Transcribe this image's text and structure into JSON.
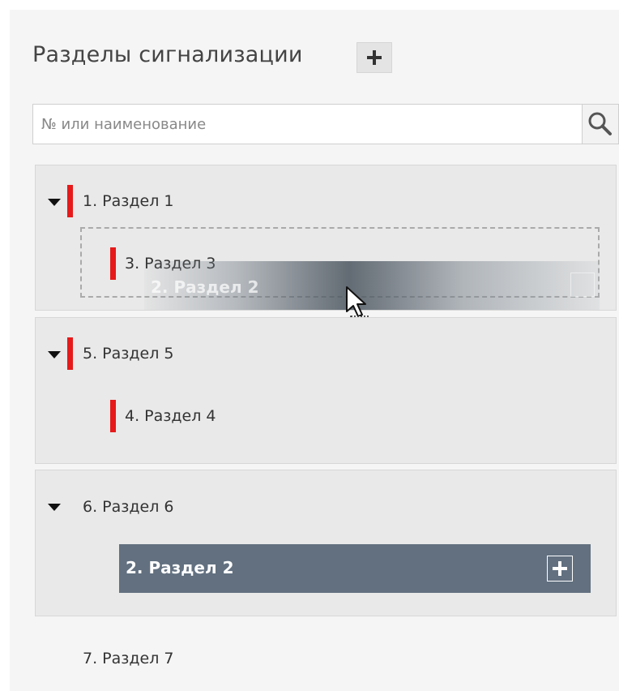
{
  "header": {
    "title": "Разделы сигнализации",
    "add_icon": "plus-icon"
  },
  "search": {
    "placeholder": "№ или наименование",
    "value": "",
    "icon": "search-icon"
  },
  "groups": [
    {
      "label": "1. Раздел 1",
      "alarm": true,
      "children": [
        {
          "label": "3. Раздел 3",
          "alarm": true
        }
      ]
    },
    {
      "label": "5. Раздел 5",
      "alarm": true,
      "children": [
        {
          "label": "4. Раздел 4",
          "alarm": true
        }
      ]
    },
    {
      "label": "6. Раздел 6",
      "alarm": false,
      "children": [
        {
          "label": "2. Раздел 2",
          "selected": true
        }
      ]
    }
  ],
  "drag": {
    "label": "2. Раздел 2"
  },
  "ungrouped": [
    {
      "label": "7. Раздел 7"
    }
  ],
  "colors": {
    "alarm": "#e61a1a",
    "selected_bg": "#627080",
    "group_bg": "#e9e9e9"
  }
}
